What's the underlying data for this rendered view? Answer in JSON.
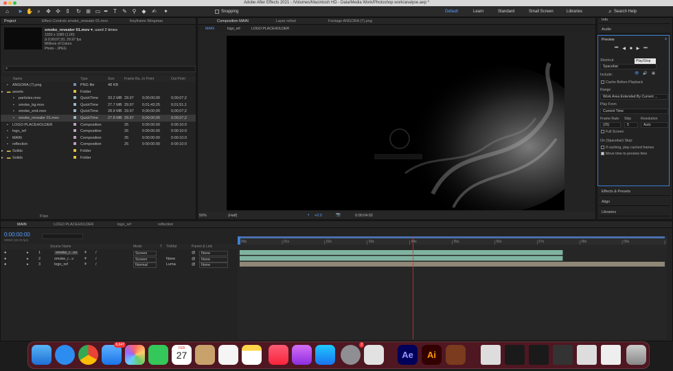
{
  "window": {
    "title": "Adobe After Effects 2021 - /Volumes/Macintosh HD - Data/Media Work/Photoshop work/analyse.aep *"
  },
  "toolbar": {
    "snapping": "Snapping",
    "workspaces": [
      "Default",
      "Learn",
      "Standard",
      "Small Screen",
      "Libraries"
    ],
    "search_placeholder": "Search Help"
  },
  "project": {
    "tabs": [
      "Project",
      "Effect Controls smoke_revealer 01.mov",
      "Keyframe Wingman"
    ],
    "selected_name": "smoke_revealer 01.mov ▾",
    "used": ", used 2 times",
    "info": [
      "1920 x 1080 (1.00)",
      "Δ 0;00;07;20, 29.97 fps",
      "Millions of Colors",
      "Photo - JPEG"
    ],
    "columns": [
      "Name",
      "Type",
      "Size",
      "Frame Ra...",
      "In Point",
      "Out Point"
    ],
    "items": [
      {
        "name": "ANGORA (7).png",
        "type": "PNG file",
        "size": "48 KB",
        "fps": "",
        "in": "",
        "out": "",
        "color": "#6f8fb8",
        "indent": 0,
        "sel": false
      },
      {
        "name": "assets",
        "type": "Folder",
        "size": "",
        "fps": "",
        "in": "",
        "out": "",
        "color": "#e0c040",
        "indent": 0,
        "sel": false
      },
      {
        "name": "particles.mov",
        "type": "QuickTime",
        "size": "33.2 MB",
        "fps": "29.97",
        "in": "0;00;00;00",
        "out": "0;00;07;2",
        "color": "#9ab8c8",
        "indent": 1,
        "sel": false
      },
      {
        "name": "smoke_bg.mov",
        "type": "QuickTime",
        "size": "27.7 MB",
        "fps": "29.97",
        "in": "0;01;43;25",
        "out": "0;01;51;1",
        "color": "#9ab8c8",
        "indent": 1,
        "sel": false
      },
      {
        "name": "smoke_end.mov",
        "type": "QuickTime",
        "size": "28.9 MB",
        "fps": "29.97",
        "in": "0;00;00;00",
        "out": "0;00;07;2",
        "color": "#9ab8c8",
        "indent": 1,
        "sel": false
      },
      {
        "name": "smoke_revealer 01.mov",
        "type": "QuickTime",
        "size": "27.8 MB",
        "fps": "29.97",
        "in": "0;00;00;00",
        "out": "0;00;07;2",
        "color": "#9ab8c8",
        "indent": 1,
        "sel": true
      },
      {
        "name": "LOGO PLACEHOLDER",
        "type": "Composition",
        "size": "",
        "fps": "25",
        "in": "0:00:00:00",
        "out": "0:00:10:0",
        "color": "#c0a0c0",
        "indent": 0,
        "sel": false
      },
      {
        "name": "logo_ref",
        "type": "Composition",
        "size": "",
        "fps": "25",
        "in": "0:00:00:00",
        "out": "0:00:10:0",
        "color": "#c0a0c0",
        "indent": 0,
        "sel": false
      },
      {
        "name": "MAIN",
        "type": "Composition",
        "size": "",
        "fps": "25",
        "in": "0:00:00:00",
        "out": "0:00:10:0",
        "color": "#c0a0c0",
        "indent": 0,
        "sel": false
      },
      {
        "name": "reflection",
        "type": "Composition",
        "size": "",
        "fps": "25",
        "in": "0:00:00:00",
        "out": "0:00:10:0",
        "color": "#c0a0c0",
        "indent": 0,
        "sel": false
      },
      {
        "name": "Solids",
        "type": "Folder",
        "size": "",
        "fps": "",
        "in": "",
        "out": "",
        "color": "#e0c040",
        "indent": 0,
        "sel": false
      },
      {
        "name": "Solids",
        "type": "Folder",
        "size": "",
        "fps": "",
        "in": "",
        "out": "",
        "color": "#e0c040",
        "indent": 0,
        "sel": false
      }
    ],
    "bpc": "8 bpc"
  },
  "comp": {
    "tabs": [
      "Composition MAIN",
      "Layer refsol",
      "Footage ANGORA (7).png"
    ],
    "breadcrumbs": [
      "MAIN",
      "logo_ref",
      "LOGO PLACEHOLDER"
    ],
    "zoom": "50%",
    "quality": "(Half)",
    "exposure": "+0.0",
    "timecode": "0:00:04:02"
  },
  "right": {
    "sections_top": [
      "Info",
      "Audio"
    ],
    "preview": {
      "title": "Preview",
      "tooltip": "Play/Stop",
      "shortcut_label": "Shortcut",
      "shortcut": "Spacebar",
      "include_label": "Include:",
      "cache": "Cache Before Playback",
      "range_label": "Range",
      "range": "Work Area Extended By Current ...",
      "play_from_label": "Play From",
      "play_from": "Current Time",
      "frame_rate_label": "Frame Rate",
      "skip_label": "Skip",
      "resolution_label": "Resolution",
      "frame_rate": "(25)",
      "skip": "5",
      "resolution": "Auto",
      "full_screen": "Full Screen",
      "on_stop": "On (Spacebar) Stop:",
      "if_caching": "If caching, play cached frames",
      "move_time": "Move time to preview time"
    },
    "sections_bottom": [
      "Effects & Presets",
      "Align",
      "Libraries"
    ]
  },
  "timeline": {
    "tabs": [
      "MAIN",
      "LOGO PLACEHOLDER",
      "logo_ref",
      "reflection"
    ],
    "timecode": "0:00:00:00",
    "timecode_sub": "00000 (25.00 fps)",
    "columns": [
      "Source Name",
      "Mode",
      "T",
      "TrkMat",
      "Parent & Link"
    ],
    "layers": [
      {
        "num": "1",
        "name": "smoke_r...ov",
        "mode": "Screen",
        "trkmat": "",
        "parent": "None"
      },
      {
        "num": "2",
        "name": "smoke_r...v",
        "mode": "Screen",
        "trkmat": "None",
        "parent": "None"
      },
      {
        "num": "3",
        "name": "logo_ref",
        "mode": "Normal",
        "trkmat": "Luma",
        "parent": "None"
      }
    ],
    "ticks": [
      "00s",
      "01s",
      "02s",
      "03s",
      "04s",
      "05s",
      "06s",
      "07s",
      "08s",
      "09s",
      "10s"
    ],
    "playhead_sec": 4.08,
    "duration_sec": 10,
    "bars": [
      {
        "start": 0,
        "end": 7.6,
        "color": "#7fb3a0"
      },
      {
        "start": 0,
        "end": 7.6,
        "color": "#7fb3a0"
      },
      {
        "start": 0,
        "end": 10,
        "color": "#8f8878"
      }
    ]
  },
  "dock": {
    "mail_badge": "6,647",
    "calendar_month": "FEB",
    "calendar_day": "27",
    "settings_badge": "2",
    "ae": "Ae",
    "ai": "Ai"
  }
}
